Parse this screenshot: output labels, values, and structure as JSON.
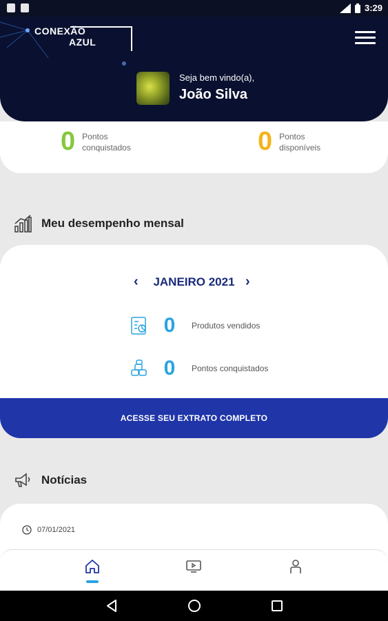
{
  "status_bar": {
    "time": "3:29",
    "network": "LTE"
  },
  "header": {
    "logo_line1": "CONEXÃO",
    "logo_line2": "AZUL",
    "welcome_text": "Seja bem vindo(a),",
    "user_name": "João Silva"
  },
  "points": [
    {
      "value": "0",
      "label": "Pontos conquistados",
      "color": "#86c83d"
    },
    {
      "value": "0",
      "label": "Pontos disponíveis",
      "color": "#f2b51c"
    }
  ],
  "performance": {
    "title": "Meu desempenho mensal",
    "month": "JANEIRO 2021",
    "stats": [
      {
        "value": "0",
        "label": "Produtos vendidos",
        "icon": "document-chart-icon"
      },
      {
        "value": "0",
        "label": "Pontos conquistados",
        "icon": "coins-stack-icon"
      }
    ],
    "cta_label": "ACESSE SEU EXTRATO COMPLETO"
  },
  "news": {
    "title": "Notícias",
    "items": [
      {
        "date": "07/01/2021"
      }
    ]
  },
  "bottom_nav": {
    "items": [
      {
        "icon": "home-icon",
        "active": true
      },
      {
        "icon": "video-icon",
        "active": false
      },
      {
        "icon": "profile-icon",
        "active": false
      }
    ]
  },
  "colors": {
    "header_bg": "#0a1030",
    "accent_blue": "#1f35a8",
    "stat_cyan": "#2aa4e0",
    "points_green": "#86c83d",
    "points_yellow": "#f2b51c"
  }
}
